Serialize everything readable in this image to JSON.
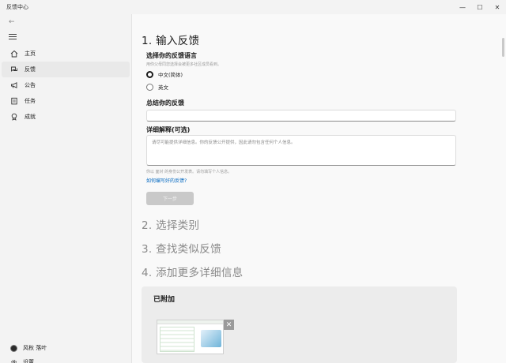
{
  "window": {
    "title": "反馈中心",
    "controls": {
      "minimize": "—",
      "maximize": "☐",
      "close": "✕"
    }
  },
  "sidebar": {
    "back_glyph": "←",
    "items": [
      {
        "label": "主页",
        "icon": "home-icon",
        "active": false
      },
      {
        "label": "反馈",
        "icon": "feedback-icon",
        "active": true
      },
      {
        "label": "公告",
        "icon": "megaphone-icon",
        "active": false
      },
      {
        "label": "任务",
        "icon": "tasks-icon",
        "active": false
      },
      {
        "label": "成就",
        "icon": "achievement-icon",
        "active": false
      }
    ],
    "user_name": "风秋 落叶",
    "settings_label": "设置"
  },
  "form": {
    "step1_title": "1. 输入反馈",
    "language_label": "选择你的反馈语言",
    "language_hint": "用你父母同您选择会被更多社区成员看到。",
    "language_options": [
      {
        "label": "中文(简体)",
        "selected": true
      },
      {
        "label": "英文",
        "selected": false
      }
    ],
    "summary_label": "总结你的反馈",
    "summary_value": "",
    "details_label": "详细解释(可选)",
    "details_placeholder": "请尽可能提供详细信息。你的反馈公开提供，因此请勿包含任何个人信息。",
    "details_hint": "你以 面对 的身份公开发表。请勿填写个人信息。",
    "help_link": "如何编写好的反馈?",
    "next_button": "下一步",
    "step2_title": "2. 选择类别",
    "step3_title": "3. 查找类似反馈",
    "step4_title": "4. 添加更多详细信息"
  },
  "attachments": {
    "title": "已附加",
    "remove_glyph": "✕"
  }
}
